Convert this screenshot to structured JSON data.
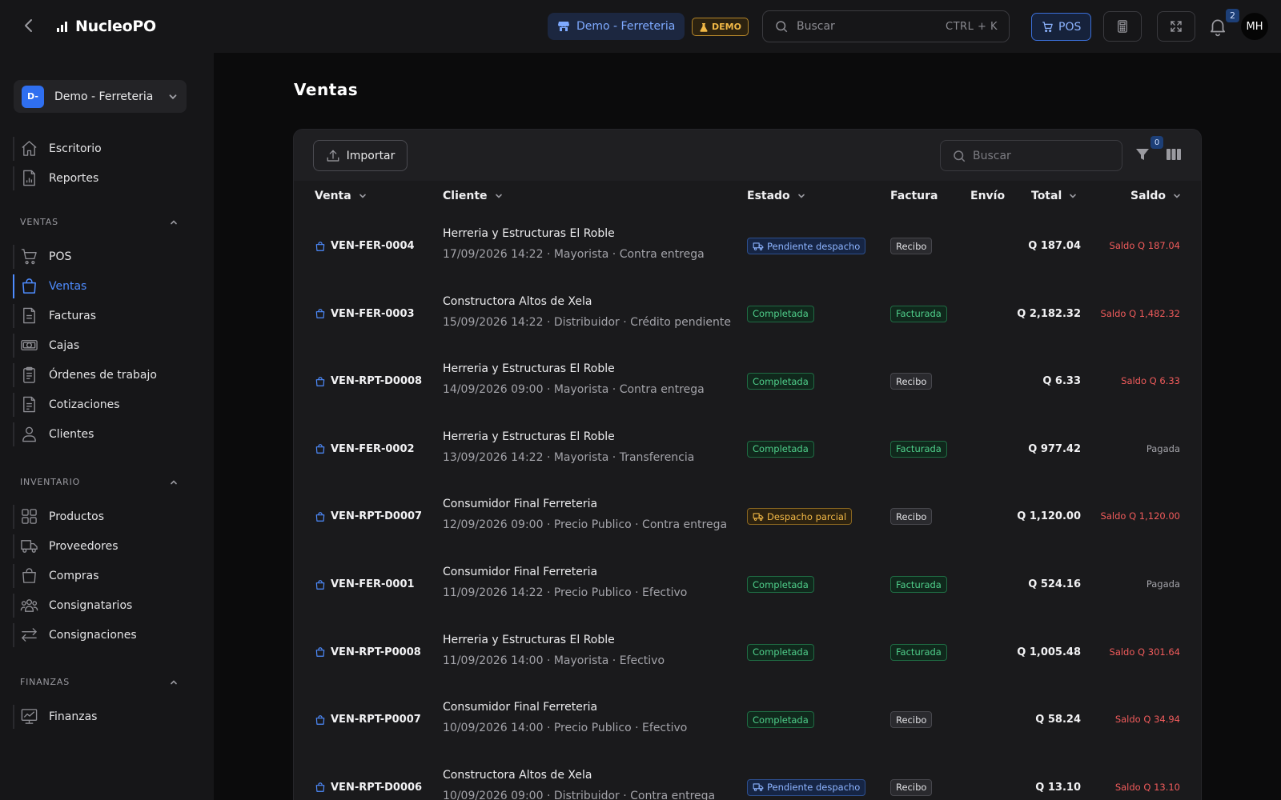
{
  "topbar": {
    "brand": "NucleoPOS",
    "store": "Demo - Ferreteria",
    "demo_badge": "DEMO",
    "search_placeholder": "Buscar",
    "search_shortcut": "CTRL + K",
    "pos_label": "POS",
    "notifications_count": "2",
    "avatar_initials": "MH"
  },
  "sidebar": {
    "company_initials": "D-",
    "company_name": "Demo - Ferreteria",
    "top_items": [
      {
        "label": "Escritorio",
        "icon": "home-icon"
      },
      {
        "label": "Reportes",
        "icon": "report-icon"
      }
    ],
    "sections": [
      {
        "title": "VENTAS",
        "items": [
          {
            "label": "POS",
            "icon": "cart-icon"
          },
          {
            "label": "Ventas",
            "icon": "bag-icon",
            "active": true
          },
          {
            "label": "Facturas",
            "icon": "document-icon"
          },
          {
            "label": "Cajas",
            "icon": "cash-icon"
          },
          {
            "label": "Órdenes de trabajo",
            "icon": "clipboard-icon"
          },
          {
            "label": "Cotizaciones",
            "icon": "quote-icon"
          },
          {
            "label": "Clientes",
            "icon": "user-icon"
          }
        ]
      },
      {
        "title": "INVENTARIO",
        "items": [
          {
            "label": "Productos",
            "icon": "grid-icon"
          },
          {
            "label": "Proveedores",
            "icon": "truck-icon"
          },
          {
            "label": "Compras",
            "icon": "shopping-bag-icon"
          },
          {
            "label": "Consignatarios",
            "icon": "users-icon"
          },
          {
            "label": "Consignaciones",
            "icon": "swap-icon"
          }
        ]
      },
      {
        "title": "FINANZAS",
        "items": [
          {
            "label": "Finanzas",
            "icon": "chart-icon"
          }
        ]
      }
    ]
  },
  "main": {
    "title": "Ventas",
    "import_label": "Importar",
    "search_placeholder": "Buscar",
    "filter_count": "0",
    "columns": {
      "venta": "Venta",
      "cliente": "Cliente",
      "estado": "Estado",
      "factura": "Factura",
      "envio": "Envío",
      "total": "Total",
      "saldo": "Saldo"
    },
    "rows": [
      {
        "venta": "VEN-FER-0004",
        "cliente": "Herreria y Estructuras El Roble",
        "meta": "17/09/2026 14:22 · Mayorista · Contra entrega",
        "estado": "Pendiente despacho",
        "estado_tipo": "pending",
        "factura": "Recibo",
        "factura_tipo": "recibo",
        "total": "Q 187.04",
        "saldo": "Saldo Q 187.04",
        "saldo_tipo": "due"
      },
      {
        "venta": "VEN-FER-0003",
        "cliente": "Constructora Altos de Xela",
        "meta": "15/09/2026 14:22 · Distribuidor · Crédito pendiente",
        "estado": "Completada",
        "estado_tipo": "done",
        "factura": "Facturada",
        "factura_tipo": "facturada",
        "total": "Q 2,182.32",
        "saldo": "Saldo Q 1,482.32",
        "saldo_tipo": "due"
      },
      {
        "venta": "VEN-RPT-D0008",
        "cliente": "Herreria y Estructuras El Roble",
        "meta": "14/09/2026 09:00 · Mayorista · Contra entrega",
        "estado": "Completada",
        "estado_tipo": "done",
        "factura": "Recibo",
        "factura_tipo": "recibo",
        "total": "Q 6.33",
        "saldo": "Saldo Q 6.33",
        "saldo_tipo": "due"
      },
      {
        "venta": "VEN-FER-0002",
        "cliente": "Herreria y Estructuras El Roble",
        "meta": "13/09/2026 14:22 · Mayorista · Transferencia",
        "estado": "Completada",
        "estado_tipo": "done",
        "factura": "Facturada",
        "factura_tipo": "facturada",
        "total": "Q 977.42",
        "saldo": "Pagada",
        "saldo_tipo": "paid"
      },
      {
        "venta": "VEN-RPT-D0007",
        "cliente": "Consumidor Final Ferreteria",
        "meta": "12/09/2026 09:00 · Precio Publico · Contra entrega",
        "estado": "Despacho parcial",
        "estado_tipo": "partial",
        "factura": "Recibo",
        "factura_tipo": "recibo",
        "total": "Q 1,120.00",
        "saldo": "Saldo Q 1,120.00",
        "saldo_tipo": "due"
      },
      {
        "venta": "VEN-FER-0001",
        "cliente": "Consumidor Final Ferreteria",
        "meta": "11/09/2026 14:22 · Precio Publico · Efectivo",
        "estado": "Completada",
        "estado_tipo": "done",
        "factura": "Facturada",
        "factura_tipo": "facturada",
        "total": "Q 524.16",
        "saldo": "Pagada",
        "saldo_tipo": "paid"
      },
      {
        "venta": "VEN-RPT-P0008",
        "cliente": "Herreria y Estructuras El Roble",
        "meta": "11/09/2026 14:00 · Mayorista · Efectivo",
        "estado": "Completada",
        "estado_tipo": "done",
        "factura": "Facturada",
        "factura_tipo": "facturada",
        "total": "Q 1,005.48",
        "saldo": "Saldo Q 301.64",
        "saldo_tipo": "due"
      },
      {
        "venta": "VEN-RPT-P0007",
        "cliente": "Consumidor Final Ferreteria",
        "meta": "10/09/2026 14:00 · Precio Publico · Efectivo",
        "estado": "Completada",
        "estado_tipo": "done",
        "factura": "Recibo",
        "factura_tipo": "recibo",
        "total": "Q 58.24",
        "saldo": "Saldo Q 34.94",
        "saldo_tipo": "due"
      },
      {
        "venta": "VEN-RPT-D0006",
        "cliente": "Constructora Altos de Xela",
        "meta": "10/09/2026 09:00 · Distribuidor · Contra entrega",
        "estado": "Pendiente despacho",
        "estado_tipo": "pending",
        "factura": "Recibo",
        "factura_tipo": "recibo",
        "total": "Q 13.10",
        "saldo": "Saldo Q 13.10",
        "saldo_tipo": "due"
      }
    ]
  },
  "colors": {
    "accent": "#4e8cff",
    "pending_text": "#8db4ff",
    "done_text": "#4fce8a",
    "partial_text": "#f1b846",
    "due_text": "#f05b5b",
    "paid_text": "#a3a3a9"
  }
}
